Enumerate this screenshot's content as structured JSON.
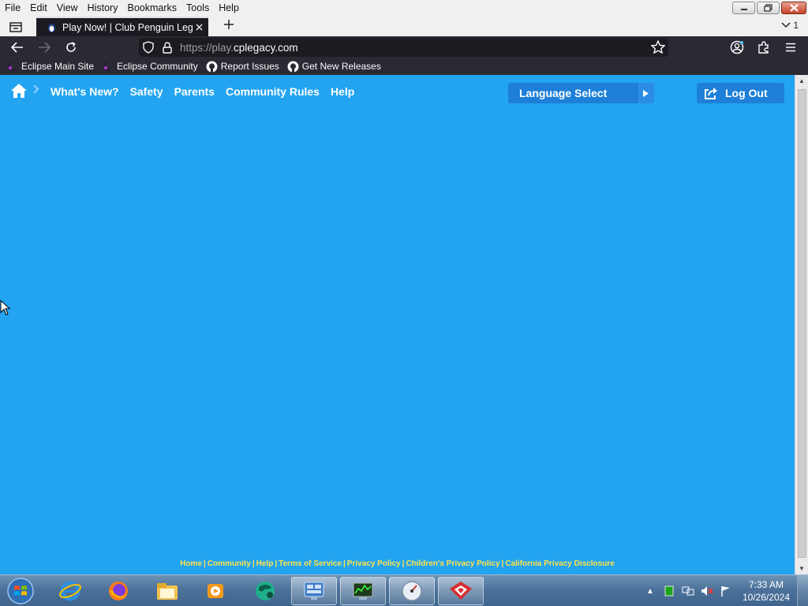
{
  "menubar": {
    "items": [
      "File",
      "Edit",
      "View",
      "History",
      "Bookmarks",
      "Tools",
      "Help"
    ]
  },
  "window_controls": [
    "minimize",
    "restore",
    "close"
  ],
  "tabs": [
    {
      "title": "Play Now! | Club Penguin Legac",
      "close_icon": "close-icon"
    }
  ],
  "tabbar": {
    "menu_chevron": "1"
  },
  "navigation": {
    "url_prefix": "https://play.",
    "url_domain": "cplegacy.com"
  },
  "bookmarks": [
    {
      "label": "Eclipse Main Site",
      "icon": "eclipse-icon"
    },
    {
      "label": "Eclipse Community",
      "icon": "eclipse-icon"
    },
    {
      "label": "Report Issues",
      "icon": "github-icon"
    },
    {
      "label": "Get New Releases",
      "icon": "github-icon"
    }
  ],
  "site": {
    "nav_links": [
      "What's New?",
      "Safety",
      "Parents",
      "Community Rules",
      "Help"
    ],
    "language_select": "Language Select",
    "logout": "Log Out",
    "footer_links": [
      "Home",
      "Community",
      "Help",
      "Terms of Service",
      "Privacy Policy",
      "Children's Privacy Policy",
      "California Privacy Disclosure"
    ]
  },
  "taskbar": {
    "apps": [
      "internet-explorer-icon",
      "firefox-icon",
      "file-explorer-icon",
      "media-player-icon",
      "globe-app-icon",
      "control-panel-icon",
      "task-monitor-icon",
      "speedometer-icon",
      "penguin-app-icon"
    ],
    "clock_time": "7:33 AM",
    "clock_date": "10/26/2024"
  },
  "colors": {
    "page_background": "#22a4f0",
    "button_blue": "#1d7fd8",
    "footer_link": "#ffe24a",
    "browser_dark": "#2b2a33"
  }
}
